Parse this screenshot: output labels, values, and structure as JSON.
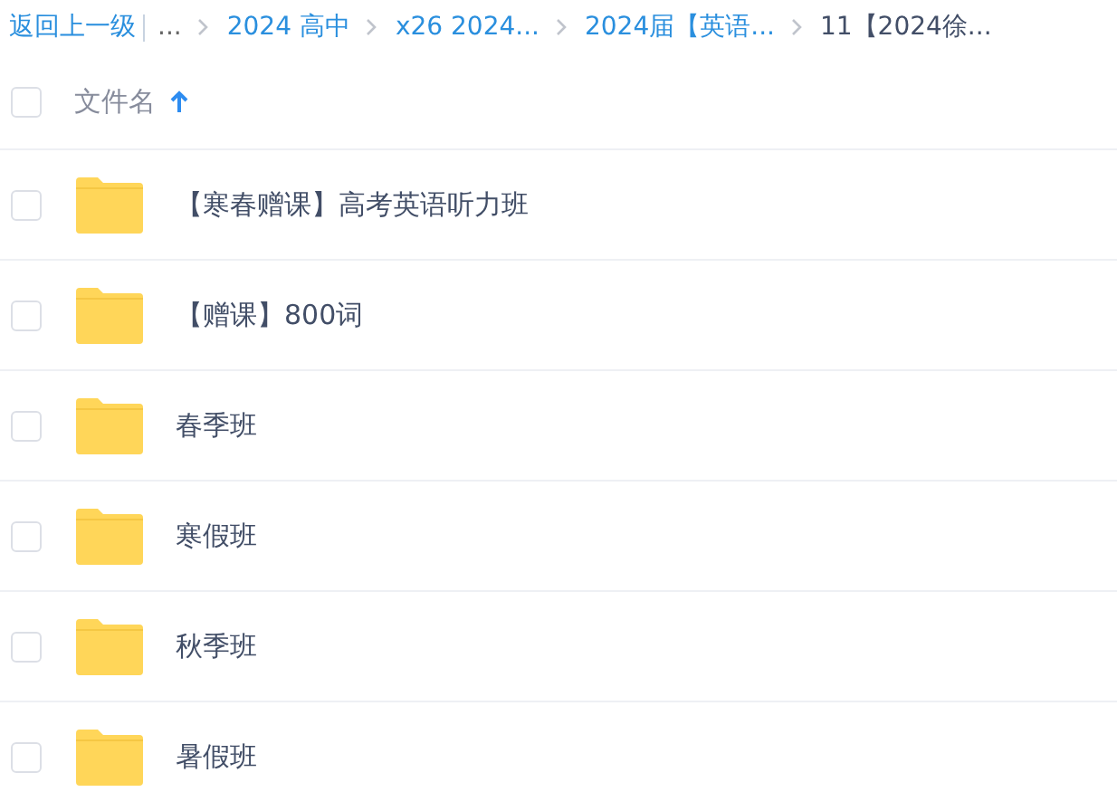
{
  "breadcrumb": {
    "back": "返回上一级",
    "ellipsis": "...",
    "items": [
      {
        "label": "2024 高中",
        "current": false
      },
      {
        "label": "x26 2024...",
        "current": false
      },
      {
        "label": "2024届【英语...",
        "current": false
      },
      {
        "label": "11【2024徐...",
        "current": true
      }
    ]
  },
  "header": {
    "checked": false,
    "column": "文件名"
  },
  "files": [
    {
      "name": "【寒春赠课】高考英语听力班",
      "checked": false
    },
    {
      "name": "【赠课】800词",
      "checked": false
    },
    {
      "name": "春季班",
      "checked": false
    },
    {
      "name": "寒假班",
      "checked": false
    },
    {
      "name": "秋季班",
      "checked": false
    },
    {
      "name": "暑假班",
      "checked": false
    }
  ]
}
